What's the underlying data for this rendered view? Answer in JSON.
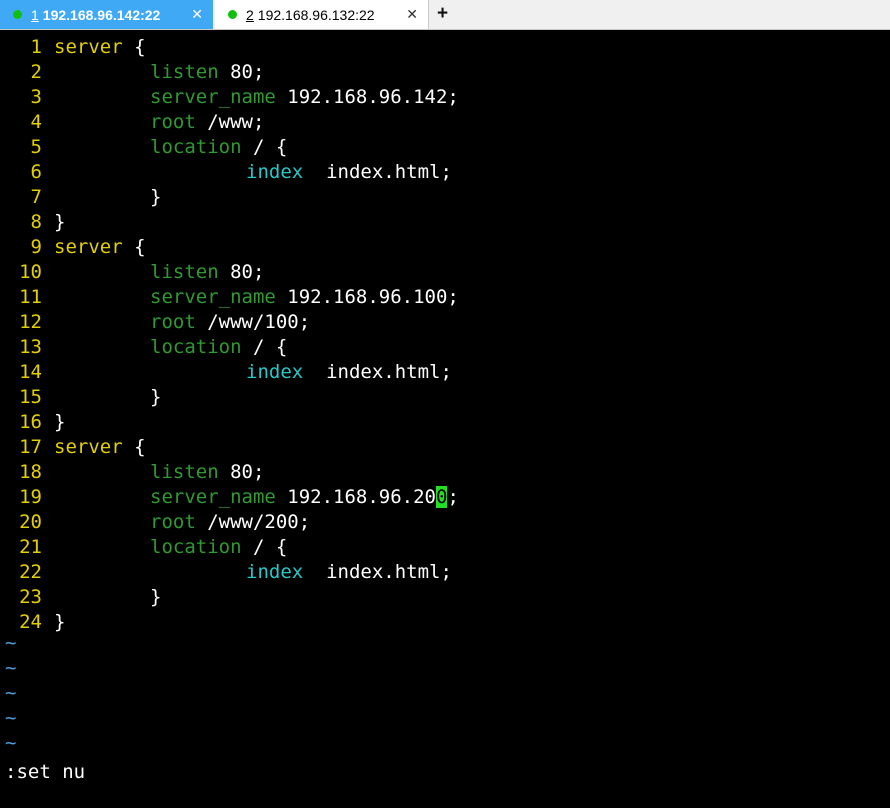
{
  "tabs": [
    {
      "number": "1",
      "label": "192.168.96.142:22",
      "close": "✕"
    },
    {
      "number": "2",
      "label": "192.168.96.132:22",
      "close": "✕"
    }
  ],
  "new_tab": "+",
  "colors": {
    "line_number": "#e4d000",
    "directive": "#2f9a2f",
    "index": "#28c8c8",
    "cursor": "#22e022",
    "tilde": "#4aa0e0"
  },
  "lines": [
    {
      "n": "1",
      "a": "server",
      "b": " {",
      "type": "block"
    },
    {
      "n": "2",
      "a": "listen",
      "b": " 80;",
      "type": "dir"
    },
    {
      "n": "3",
      "a": "server_name",
      "b": " 192.168.96.142;",
      "type": "dir"
    },
    {
      "n": "4",
      "a": "root",
      "b": " /www;",
      "type": "dir"
    },
    {
      "n": "5",
      "a": "location",
      "b": " / {",
      "type": "dir"
    },
    {
      "n": "6",
      "a": "index",
      "b": "  index.html;",
      "type": "idx"
    },
    {
      "n": "7",
      "a": "",
      "b": "}",
      "type": "close"
    },
    {
      "n": "8",
      "a": "",
      "b": "}",
      "type": "end"
    },
    {
      "n": "9",
      "a": "server",
      "b": " {",
      "type": "block"
    },
    {
      "n": "10",
      "a": "listen",
      "b": " 80;",
      "type": "dir"
    },
    {
      "n": "11",
      "a": "server_name",
      "b": " 192.168.96.100;",
      "type": "dir"
    },
    {
      "n": "12",
      "a": "root",
      "b": " /www/100;",
      "type": "dir"
    },
    {
      "n": "13",
      "a": "location",
      "b": " / {",
      "type": "dir"
    },
    {
      "n": "14",
      "a": "index",
      "b": "  index.html;",
      "type": "idx"
    },
    {
      "n": "15",
      "a": "",
      "b": "}",
      "type": "close"
    },
    {
      "n": "16",
      "a": "",
      "b": "}",
      "type": "end"
    },
    {
      "n": "17",
      "a": "server",
      "b": " {",
      "type": "block"
    },
    {
      "n": "18",
      "a": "listen",
      "b": " 80;",
      "type": "dir"
    },
    {
      "n": "19",
      "a": "server_name",
      "b": " 192.168.96.20",
      "cur": "0",
      "after": ";",
      "type": "dir"
    },
    {
      "n": "20",
      "a": "root",
      "b": " /www/200;",
      "type": "dir"
    },
    {
      "n": "21",
      "a": "location",
      "b": " / {",
      "type": "dir"
    },
    {
      "n": "22",
      "a": "index",
      "b": "  index.html;",
      "type": "idx"
    },
    {
      "n": "23",
      "a": "",
      "b": "}",
      "type": "close"
    },
    {
      "n": "24",
      "a": "",
      "b": "}",
      "type": "end"
    }
  ],
  "tildes": [
    "~",
    "~",
    "~",
    "~",
    "~"
  ],
  "command_line": ":set nu"
}
